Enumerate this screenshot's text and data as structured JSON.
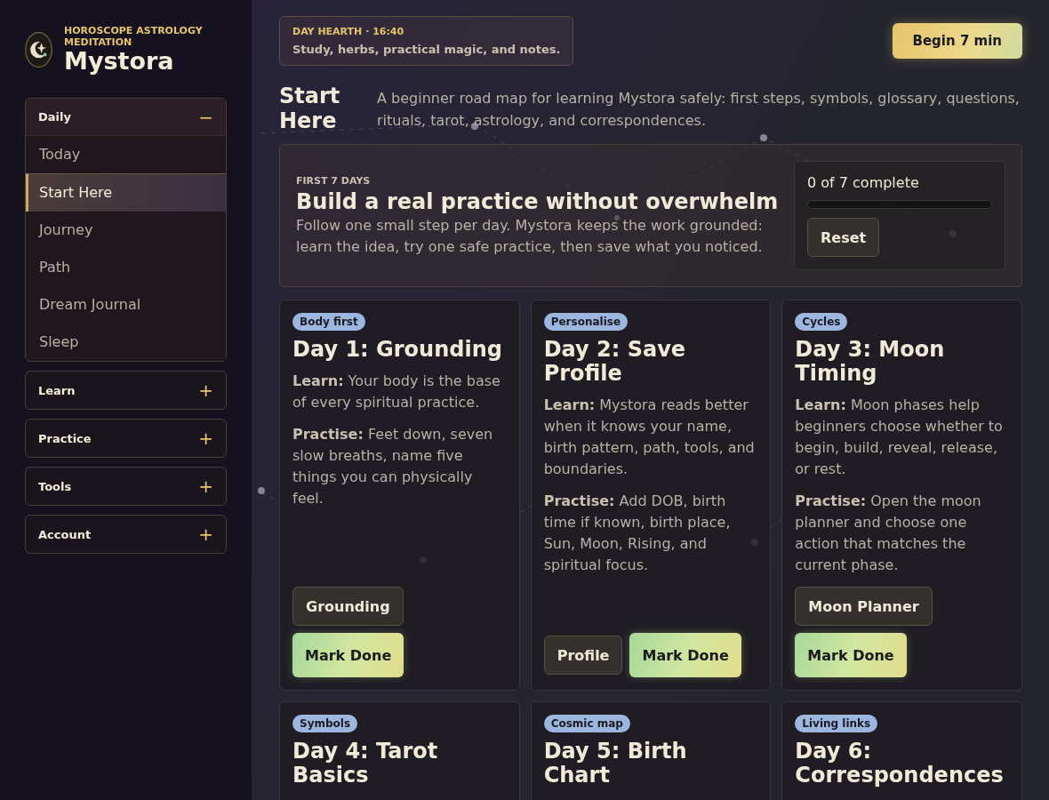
{
  "brand": {
    "tagline": "HOROSCOPE ASTROLOGY MEDITATION",
    "name": "Mystora"
  },
  "sidebar": {
    "groups": [
      {
        "label": "Daily",
        "expanded": true,
        "toggle": "−",
        "items": [
          {
            "label": "Today",
            "selected": false
          },
          {
            "label": "Start Here",
            "selected": true
          },
          {
            "label": "Journey",
            "selected": false
          },
          {
            "label": "Path",
            "selected": false
          },
          {
            "label": "Dream Journal",
            "selected": false
          },
          {
            "label": "Sleep",
            "selected": false
          }
        ]
      },
      {
        "label": "Learn",
        "expanded": false,
        "toggle": "+"
      },
      {
        "label": "Practice",
        "expanded": false,
        "toggle": "+"
      },
      {
        "label": "Tools",
        "expanded": false,
        "toggle": "+"
      },
      {
        "label": "Account",
        "expanded": false,
        "toggle": "+"
      }
    ]
  },
  "hearth": {
    "label": "DAY HEARTH · 16:40",
    "text": "Study, herbs, practical magic, and notes."
  },
  "begin_button": "Begin 7 min",
  "page": {
    "title": "Start Here",
    "description": "A beginner road map for learning Mystora safely: first steps, symbols, glossary, questions, rituals, tarot, astrology, and correspondences."
  },
  "intro": {
    "eyebrow": "FIRST 7 DAYS",
    "title": "Build a real practice without overwhelm",
    "text": "Follow one small step per day. Mystora keeps the work grounded: learn the idea, try one safe practice, then save what you noticed.",
    "progress": {
      "label": "0 of 7 complete",
      "level": 0
    },
    "reset": "Reset"
  },
  "days": [
    {
      "tag": "Body first",
      "title": "Day 1: Grounding",
      "learn": "**Learn:** Your body is the base of every spiritual practice.",
      "practise": "**Practise:** Feet down, seven slow breaths, name five things you can physically feel.",
      "buttons": [
        {
          "label": "Grounding",
          "kind": "tool"
        },
        {
          "label": "Mark Done",
          "kind": "done"
        }
      ]
    },
    {
      "tag": "Personalise",
      "title": "Day 2: Save Profile",
      "learn": "**Learn:** Mystora reads better when it knows your name, birth pattern, path, tools, and boundaries.",
      "practise": "**Practise:** Add DOB, birth time if known, birth place, Sun, Moon, Rising, and spiritual focus.",
      "buttons": [
        {
          "label": "Profile",
          "kind": "tool"
        },
        {
          "label": "Mark Done",
          "kind": "done"
        }
      ]
    },
    {
      "tag": "Cycles",
      "title": "Day 3: Moon Timing",
      "learn": "**Learn:** Moon phases help beginners choose whether to begin, build, reveal, release, or rest.",
      "practise": "**Practise:** Open the moon planner and choose one action that matches the current phase.",
      "buttons": [
        {
          "label": "Moon Planner",
          "kind": "tool"
        },
        {
          "label": "Mark Done",
          "kind": "done"
        }
      ]
    },
    {
      "tag": "Symbols",
      "title": "Day 4: Tarot Basics"
    },
    {
      "tag": "Cosmic map",
      "title": "Day 5: Birth Chart"
    },
    {
      "tag": "Living links",
      "title": "Day 6: Correspondences"
    }
  ]
}
